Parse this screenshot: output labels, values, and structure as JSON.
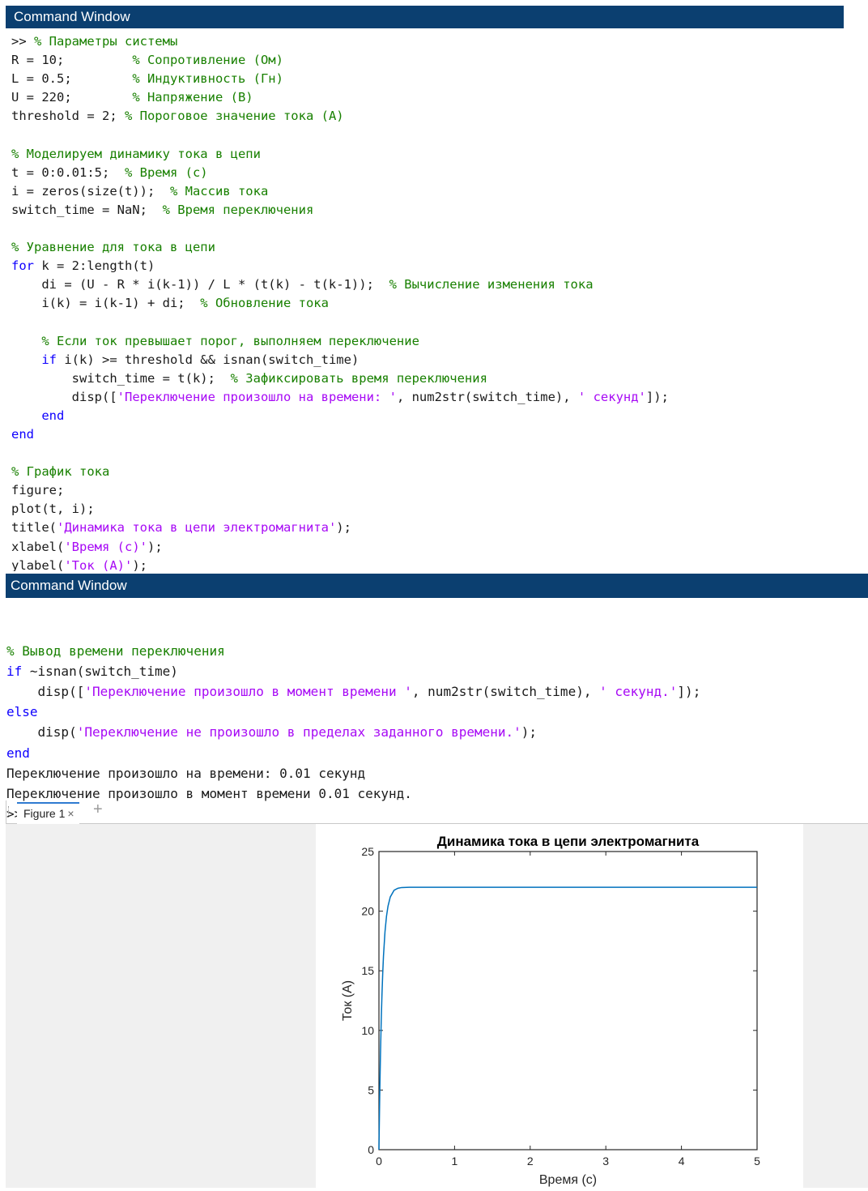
{
  "window1": {
    "title": "Command Window",
    "lines": [
      [
        {
          "t": "",
          "c": "p"
        },
        {
          "t": ">> ",
          "c": "p"
        },
        {
          "t": "% Параметры системы",
          "c": "c"
        }
      ],
      [
        {
          "t": "R = 10;         ",
          "c": "p"
        },
        {
          "t": "% Сопротивление (Ом)",
          "c": "c"
        }
      ],
      [
        {
          "t": "L = 0.5;        ",
          "c": "p"
        },
        {
          "t": "% Индуктивность (Гн)",
          "c": "c"
        }
      ],
      [
        {
          "t": "U = 220;        ",
          "c": "p"
        },
        {
          "t": "% Напряжение (В)",
          "c": "c"
        }
      ],
      [
        {
          "t": "threshold = 2; ",
          "c": "p"
        },
        {
          "t": "% Пороговое значение тока (А)",
          "c": "c"
        }
      ],
      [],
      [
        {
          "t": "% Моделируем динамику тока в цепи",
          "c": "c"
        }
      ],
      [
        {
          "t": "t = 0:0.01:5;  ",
          "c": "p"
        },
        {
          "t": "% Время (с)",
          "c": "c"
        }
      ],
      [
        {
          "t": "i = zeros(size(t));  ",
          "c": "p"
        },
        {
          "t": "% Массив тока",
          "c": "c"
        }
      ],
      [
        {
          "t": "switch_time = NaN;  ",
          "c": "p"
        },
        {
          "t": "% Время переключения",
          "c": "c"
        }
      ],
      [],
      [
        {
          "t": "% Уравнение для тока в цепи",
          "c": "c"
        }
      ],
      [
        {
          "t": "for",
          "c": "k"
        },
        {
          "t": " k = 2:length(t)",
          "c": "p"
        }
      ],
      [
        {
          "t": "    di = (U - R * i(k-1)) / L * (t(k) - t(k-1));  ",
          "c": "p"
        },
        {
          "t": "% Вычисление изменения тока",
          "c": "c"
        }
      ],
      [
        {
          "t": "    i(k) = i(k-1) + di;  ",
          "c": "p"
        },
        {
          "t": "% Обновление тока",
          "c": "c"
        }
      ],
      [],
      [
        {
          "t": "    % Если ток превышает порог, выполняем переключение",
          "c": "c"
        }
      ],
      [
        {
          "t": "    ",
          "c": "p"
        },
        {
          "t": "if",
          "c": "k"
        },
        {
          "t": " i(k) >= threshold && isnan(switch_time)",
          "c": "p"
        }
      ],
      [
        {
          "t": "        switch_time = t(k);  ",
          "c": "p"
        },
        {
          "t": "% Зафиксировать время переключения",
          "c": "c"
        }
      ],
      [
        {
          "t": "        disp([",
          "c": "p"
        },
        {
          "t": "'Переключение произошло на времени: '",
          "c": "s"
        },
        {
          "t": ", num2str(switch_time), ",
          "c": "p"
        },
        {
          "t": "' секунд'",
          "c": "s"
        },
        {
          "t": "]);",
          "c": "p"
        }
      ],
      [
        {
          "t": "    ",
          "c": "p"
        },
        {
          "t": "end",
          "c": "k"
        }
      ],
      [
        {
          "t": "end",
          "c": "k"
        }
      ],
      [],
      [
        {
          "t": "% График тока",
          "c": "c"
        }
      ],
      [
        {
          "t": "figure;",
          "c": "p"
        }
      ],
      [
        {
          "t": "plot(t, i);",
          "c": "p"
        }
      ],
      [
        {
          "t": "title(",
          "c": "p"
        },
        {
          "t": "'Динамика тока в цепи электромагнита'",
          "c": "s"
        },
        {
          "t": ");",
          "c": "p"
        }
      ],
      [
        {
          "t": "xlabel(",
          "c": "p"
        },
        {
          "t": "'Время (с)'",
          "c": "s"
        },
        {
          "t": ");",
          "c": "p"
        }
      ],
      [
        {
          "t": "ylabel(",
          "c": "p"
        },
        {
          "t": "'Ток (А)'",
          "c": "s"
        },
        {
          "t": ");",
          "c": "p"
        }
      ]
    ]
  },
  "window2": {
    "title": "Command Window",
    "lines": [
      [],
      [
        {
          "t": "% Вывод времени переключения",
          "c": "c"
        }
      ],
      [
        {
          "t": "if",
          "c": "k"
        },
        {
          "t": " ~isnan(switch_time)",
          "c": "p"
        }
      ],
      [
        {
          "t": "    disp([",
          "c": "p"
        },
        {
          "t": "'Переключение произошло в момент времени '",
          "c": "s"
        },
        {
          "t": ", num2str(switch_time), ",
          "c": "p"
        },
        {
          "t": "' секунд.'",
          "c": "s"
        },
        {
          "t": "]);",
          "c": "p"
        }
      ],
      [
        {
          "t": "else",
          "c": "k"
        }
      ],
      [
        {
          "t": "    disp(",
          "c": "p"
        },
        {
          "t": "'Переключение не произошло в пределах заданного времени.'",
          "c": "s"
        },
        {
          "t": ");",
          "c": "p"
        }
      ],
      [
        {
          "t": "end",
          "c": "k"
        }
      ],
      [
        {
          "t": "Переключение произошло на времени: 0.01 секунд",
          "c": "p"
        }
      ],
      [
        {
          "t": "Переключение произошло в момент времени 0.01 секунд.",
          "c": "p"
        }
      ],
      [
        {
          "t": ">>",
          "c": "p"
        }
      ]
    ]
  },
  "figure": {
    "tab_label": "Figure 1",
    "tab_close": "×",
    "add_tab": "+"
  },
  "colors": {
    "titlebar": "#0b3f70",
    "comment": "#188000",
    "keyword": "#0e00ff",
    "string": "#a709f5",
    "plot_line": "#0072bd"
  },
  "chart_data": {
    "type": "line",
    "title": "Динамика тока в цепи электромагнита",
    "xlabel": "Время (с)",
    "ylabel": "Ток (А)",
    "xlim": [
      0,
      5
    ],
    "ylim": [
      0,
      25
    ],
    "xticks": [
      0,
      1,
      2,
      3,
      4,
      5
    ],
    "yticks": [
      0,
      5,
      10,
      15,
      20,
      25
    ],
    "grid": false,
    "legend": "none",
    "series": [
      {
        "x": [
          0,
          0.01,
          0.02,
          0.03,
          0.04,
          0.05,
          0.06,
          0.08,
          0.1,
          0.12,
          0.15,
          0.2,
          0.25,
          0.3,
          0.4,
          0.5,
          1,
          2,
          3,
          4,
          5
        ],
        "y": [
          0,
          4.4,
          7.92,
          10.74,
          12.99,
          14.79,
          16.23,
          18.27,
          19.58,
          20.42,
          21.19,
          21.75,
          21.92,
          21.98,
          22.0,
          22.0,
          22.0,
          22.0,
          22.0,
          22.0,
          22.0
        ]
      }
    ]
  }
}
